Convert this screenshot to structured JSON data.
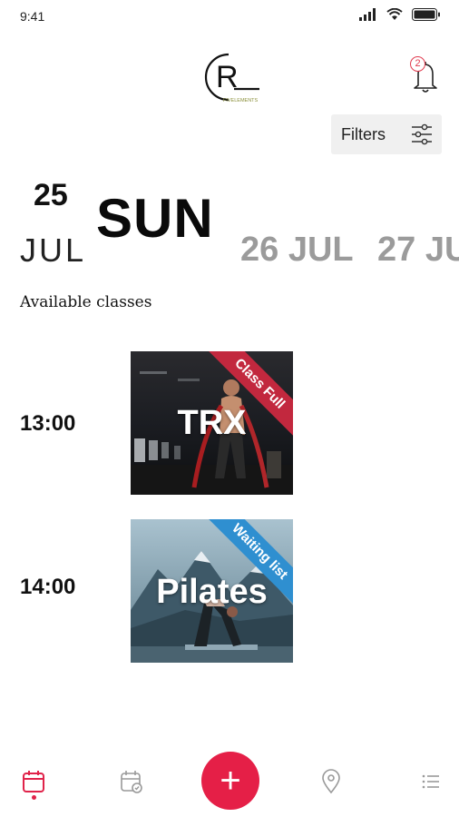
{
  "status_bar": {
    "time": "9:41",
    "icons": [
      "signal-icon",
      "wifi-icon",
      "battery-icon"
    ]
  },
  "header": {
    "logo_letter": "R",
    "logo_subtext": "FIVELEMENTS",
    "notification_count": "2"
  },
  "filters": {
    "label": "Filters"
  },
  "date_selector": {
    "selected": {
      "day": "25",
      "weekday": "SUN",
      "month": "JUL"
    },
    "others": [
      {
        "label": "26 JUL"
      },
      {
        "label": "27 JU"
      }
    ]
  },
  "section_title": "Available classes",
  "classes": [
    {
      "time": "13:00",
      "name": "TRX",
      "status": "Class Full",
      "status_color": "#c2283e"
    },
    {
      "time": "14:00",
      "name": "Pilates",
      "status": "Waiting list",
      "status_color": "#2f8fd0"
    }
  ],
  "bottom_nav": {
    "items": [
      "calendar-icon",
      "calendar-check-icon",
      "add-icon",
      "location-icon",
      "list-icon"
    ],
    "fab_label": "+",
    "accent": "#e51f47"
  }
}
